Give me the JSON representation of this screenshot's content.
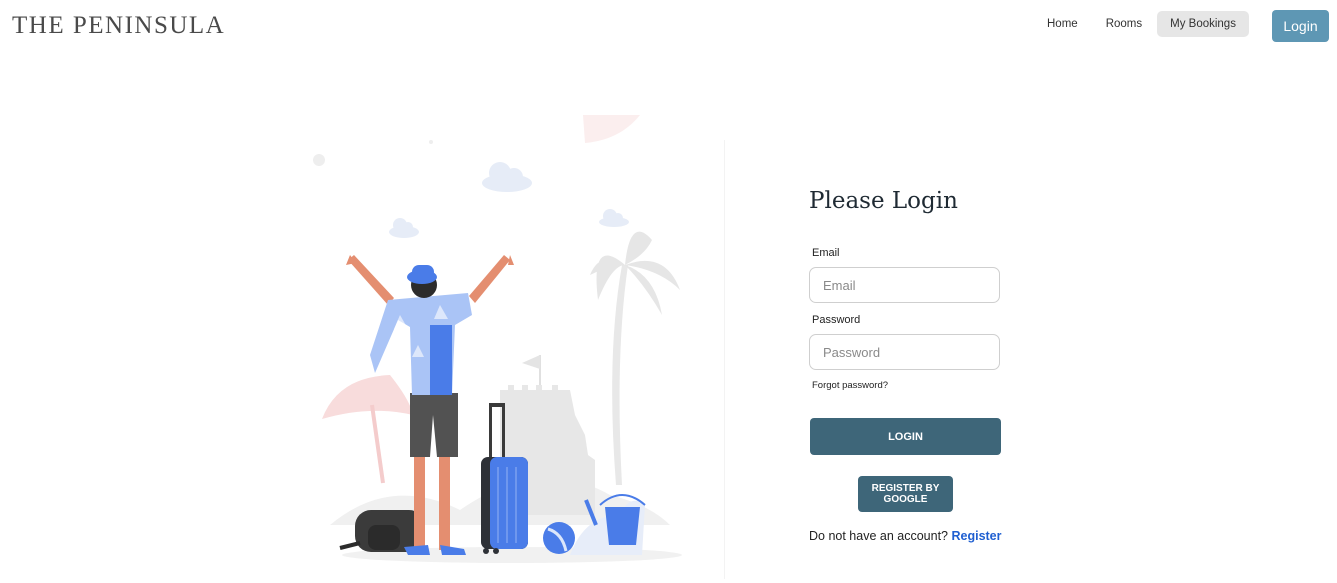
{
  "header": {
    "brand": "THE PENINSULA",
    "nav": [
      {
        "label": "Home"
      },
      {
        "label": "Rooms"
      },
      {
        "label": "My Bookings"
      }
    ],
    "login_label": "Login"
  },
  "login": {
    "title": "Please Login",
    "email_label": "Email",
    "email_placeholder": "Email",
    "password_label": "Password",
    "password_placeholder": "Password",
    "forgot_label": "Forgot password?",
    "login_button": "LOGIN",
    "google_button": "REGISTER BY\nGOOGLE",
    "no_account_text": "Do not have an account?",
    "register_link": "Register"
  },
  "colors": {
    "nav_login_bg": "#5e97b4",
    "primary_button_bg": "#3e6679",
    "register_link": "#1f5fd1",
    "illustration_accent": "#4a7ce8"
  }
}
